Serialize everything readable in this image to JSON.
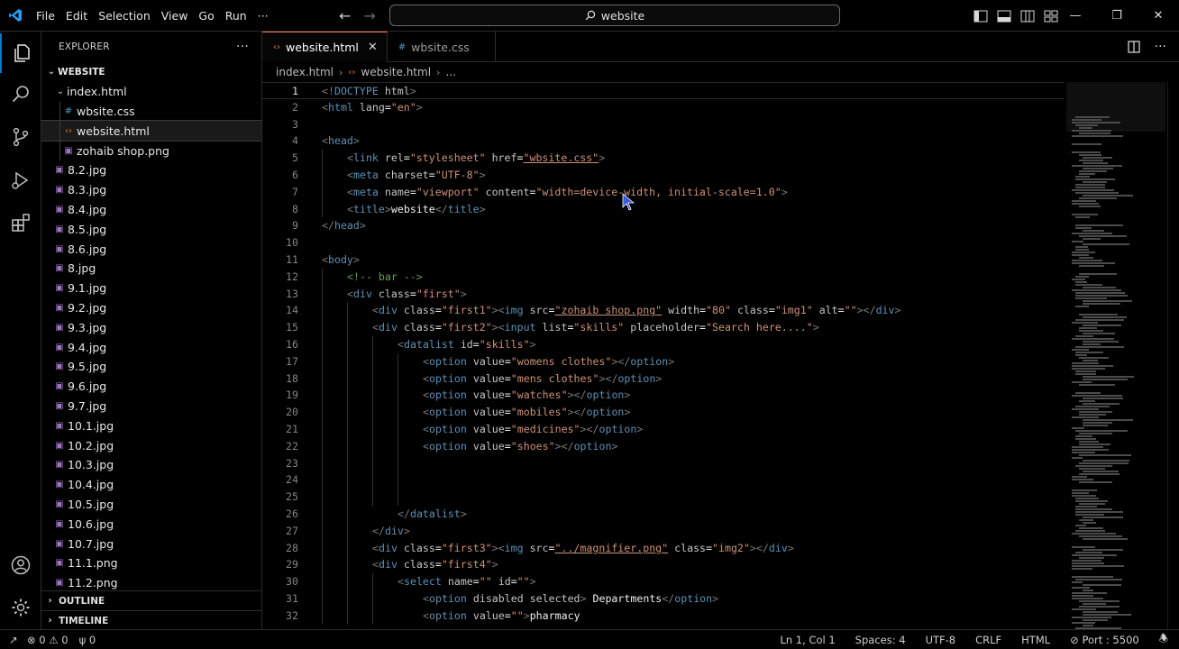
{
  "titlebar": {
    "menu": [
      "File",
      "Edit",
      "Selection",
      "View",
      "Go",
      "Run",
      "···"
    ],
    "search": "website"
  },
  "sidebar": {
    "title": "EXPLORER",
    "folder": "WEBSITE",
    "subfolder": "index.html",
    "subfiles": [
      {
        "name": "wbsite.css",
        "icon": "css-file-icon"
      },
      {
        "name": "website.html",
        "icon": "html-file-icon"
      },
      {
        "name": "zohaib shop.png",
        "icon": "image-file-icon"
      }
    ],
    "files": [
      "8.2.jpg",
      "8.3.jpg",
      "8.4.jpg",
      "8.5.jpg",
      "8.6.jpg",
      "8.jpg",
      "9.1.jpg",
      "9.2.jpg",
      "9.3.jpg",
      "9.4.jpg",
      "9.5.jpg",
      "9.6.jpg",
      "9.7.jpg",
      "10.1.jpg",
      "10.2.jpg",
      "10.3.jpg",
      "10.4.jpg",
      "10.5.jpg",
      "10.6.jpg",
      "10.7.jpg",
      "11.1.png",
      "11.2.png"
    ],
    "outline": "OUTLINE",
    "timeline": "TIMELINE"
  },
  "editor": {
    "tabs": [
      {
        "label": "website.html",
        "active": true
      },
      {
        "label": "wbsite.css",
        "active": false
      }
    ],
    "breadcrumb": [
      "index.html",
      "website.html",
      "..."
    ]
  },
  "code_lines": [
    {
      "n": 1,
      "text": "<!DOCTYPE html>"
    },
    {
      "n": 2,
      "text": "<html lang=\"en\">"
    },
    {
      "n": 3,
      "text": ""
    },
    {
      "n": 4,
      "text": "<head>"
    },
    {
      "n": 5,
      "text": "<link rel=\"stylesheet\" href=\"wbsite.css\">"
    },
    {
      "n": 6,
      "text": "<meta charset=\"UTF-8\">"
    },
    {
      "n": 7,
      "text": "<meta name=\"viewport\" content=\"width=device-width, initial-scale=1.0\">"
    },
    {
      "n": 8,
      "text": "<title>website</title>"
    },
    {
      "n": 9,
      "text": "</head>"
    },
    {
      "n": 10,
      "text": ""
    },
    {
      "n": 11,
      "text": "<body>"
    },
    {
      "n": 12,
      "text": "<!-- bar -->"
    },
    {
      "n": 13,
      "text": "<div class=\"first\">"
    },
    {
      "n": 14,
      "text": "<div class=\"first1\"><img src=\"zohaib shop.png\" width=\"80\" class=\"img1\" alt=\"\"></div>"
    },
    {
      "n": 15,
      "text": "<div class=\"first2\"><input list=\"skills\" placeholder=\"Search here....\">"
    },
    {
      "n": 16,
      "text": "<datalist id=\"skills\">"
    },
    {
      "n": 17,
      "text": "<option value=\"womens clothes\"></option>"
    },
    {
      "n": 18,
      "text": "<option value=\"mens clothes\"></option>"
    },
    {
      "n": 19,
      "text": "<option value=\"watches\"></option>"
    },
    {
      "n": 20,
      "text": "<option value=\"mobiles\"></option>"
    },
    {
      "n": 21,
      "text": "<option value=\"medicines\"></option>"
    },
    {
      "n": 22,
      "text": "<option value=\"shoes\"></option>"
    },
    {
      "n": 23,
      "text": ""
    },
    {
      "n": 24,
      "text": ""
    },
    {
      "n": 25,
      "text": ""
    },
    {
      "n": 26,
      "text": "</datalist>"
    },
    {
      "n": 27,
      "text": "</div>"
    },
    {
      "n": 28,
      "text": "<div class=\"first3\"><img src=\"../magnifier.png\" class=\"img2\"></div>"
    },
    {
      "n": 29,
      "text": "<div class=\"first4\">"
    },
    {
      "n": 30,
      "text": "<select name=\"\" id=\"\">"
    },
    {
      "n": 31,
      "text": "<option disabled selected> Departments</option>"
    },
    {
      "n": 32,
      "text": "<option value=\"\">pharmacy"
    }
  ],
  "statusbar": {
    "errors": "0",
    "warnings": "0",
    "ports": "0",
    "position": "Ln 1, Col 1",
    "spaces": "Spaces: 4",
    "encoding": "UTF-8",
    "eol": "CRLF",
    "language": "HTML",
    "port": "Port : 5500"
  },
  "colors": {
    "accent": "#0078d4",
    "tab_border": "#ff7b4d",
    "tag": "#5f8fb3",
    "string": "#ce9178",
    "comment": "#6a9955"
  }
}
